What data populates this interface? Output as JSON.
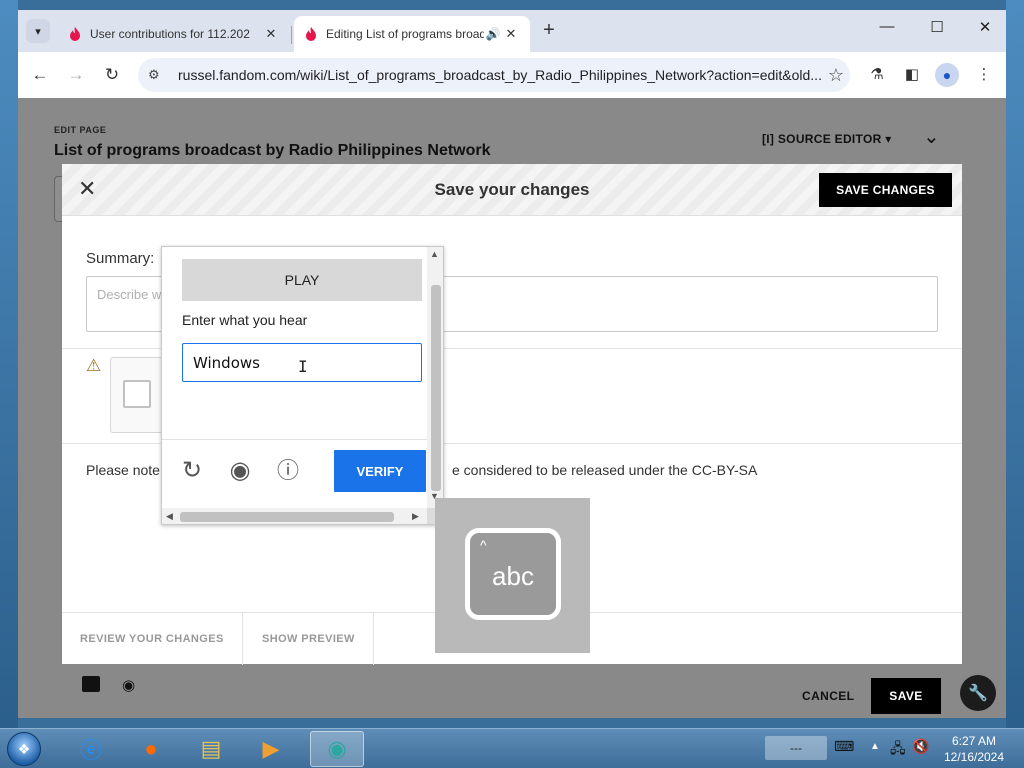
{
  "browser": {
    "tabs": [
      {
        "title": "User contributions for 112.202",
        "active": false
      },
      {
        "title": "Editing List of programs broadcast by Radio Philippines Network",
        "active": true
      }
    ],
    "url": "russel.fandom.com/wiki/List_of_programs_broadcast_by_Radio_Philippines_Network?action=edit&old..."
  },
  "page": {
    "edit_label": "EDIT PAGE",
    "title": "List of programs broadcast by Radio Philippines Network",
    "source_editor": "SOURCE EDITOR",
    "cancel": "CANCEL",
    "save": "SAVE"
  },
  "dialog": {
    "title": "Save your changes",
    "save_changes": "SAVE CHANGES",
    "summary_label": "Summary:",
    "summary_placeholder": "Describe w",
    "note_start": "Please note",
    "note_end": "e considered to be released under the CC-BY-SA",
    "review_changes": "REVIEW YOUR CHANGES",
    "show_preview": "SHOW PREVIEW"
  },
  "captcha": {
    "play": "PLAY",
    "prompt": "Enter what you hear",
    "input_value": "Windows",
    "verify": "VERIFY"
  },
  "osk": {
    "label": "abc"
  },
  "taskbar": {
    "tray_text": "---",
    "time": "6:27 AM",
    "date": "12/16/2024"
  },
  "colors": {
    "verify_blue": "#1a73e8",
    "dimmed_page": "#898989",
    "taskbar": "#4a7aa6"
  }
}
